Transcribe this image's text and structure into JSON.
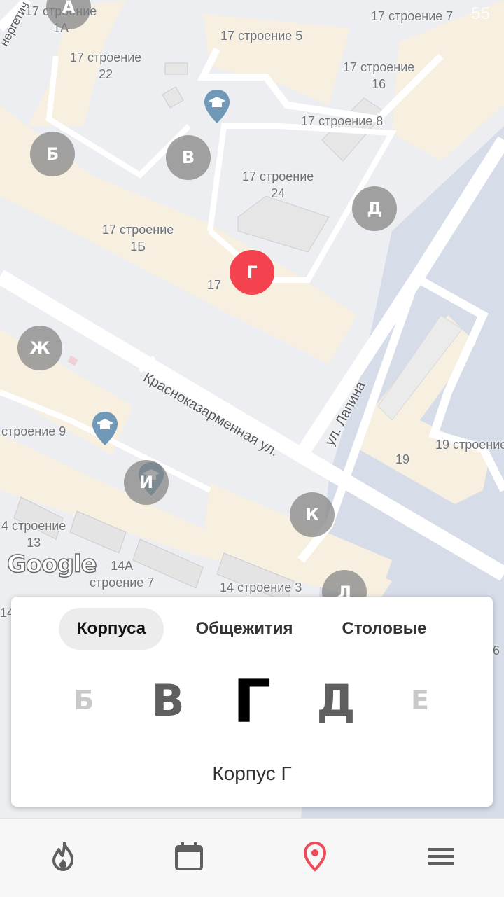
{
  "map": {
    "labels": [
      {
        "text": "17 строение\n1А"
      },
      {
        "text": "17 строение 5"
      },
      {
        "text": "17 строение 7"
      },
      {
        "text": "17 строение\n22"
      },
      {
        "text": "17 строение\n16"
      },
      {
        "text": "17 строение 8"
      },
      {
        "text": "17 строение\n24"
      },
      {
        "text": "17 строение\n1Б"
      },
      {
        "text": "17"
      },
      {
        "text": "строение 9"
      },
      {
        "text": "19"
      },
      {
        "text": "19 строение"
      },
      {
        "text": "4 строение\n13"
      },
      {
        "text": "14А\nстроение 7"
      },
      {
        "text": "14 строение 3"
      },
      {
        "text": "14"
      },
      {
        "text": "6"
      }
    ],
    "streets": {
      "krasnokazarmennaya": "Красноказарменная ул.",
      "lapina": "ул. Лапина",
      "energeticheskaya": "нергетич"
    },
    "markers": [
      {
        "letter": "А"
      },
      {
        "letter": "Б"
      },
      {
        "letter": "В"
      },
      {
        "letter": "Д"
      },
      {
        "letter": "Г"
      },
      {
        "letter": "Ж"
      },
      {
        "letter": "И"
      },
      {
        "letter": "К"
      },
      {
        "letter": "Л"
      }
    ],
    "active_color": "#f5424f",
    "google_logo": "Google",
    "status_time": "55"
  },
  "panel": {
    "tabs": [
      "Корпуса",
      "Общежития",
      "Столовые"
    ],
    "selected_tab": "Корпуса",
    "letters": [
      "Б",
      "В",
      "Г",
      "Д",
      "Е"
    ],
    "selected_letter": "Г",
    "selected_title": "Корпус Г"
  },
  "bottom_nav": {
    "icons": [
      "flame-icon",
      "calendar-icon",
      "location-pin-icon",
      "menu-icon"
    ],
    "active": "location-pin-icon",
    "active_color": "#ee4b5a"
  }
}
